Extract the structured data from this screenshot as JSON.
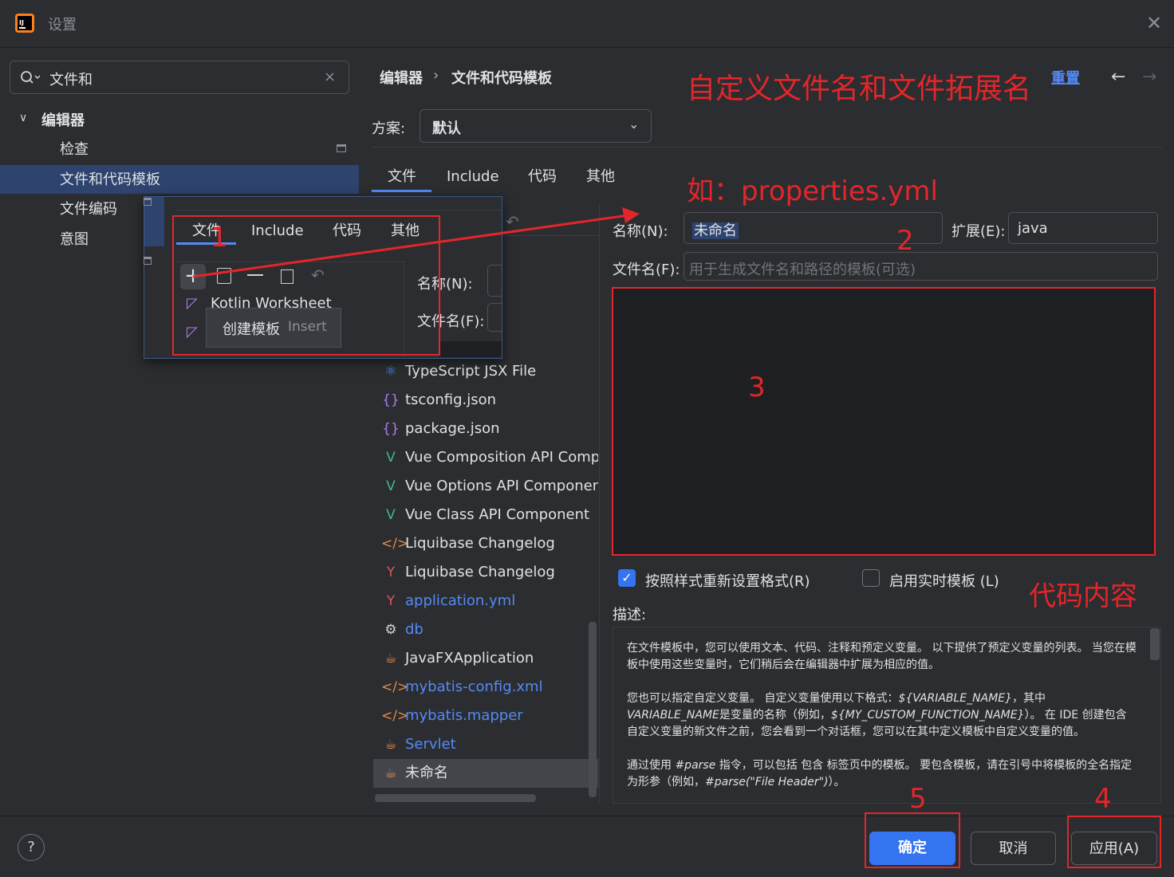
{
  "window": {
    "title": "设置",
    "close_icon": "close-icon"
  },
  "search": {
    "value": "文件和",
    "clear": "×"
  },
  "tree": {
    "root": "编辑器",
    "items": [
      "检查",
      "文件和代码模板",
      "文件编码",
      "意图"
    ]
  },
  "breadcrumb": {
    "first": "编辑器",
    "separator": "›",
    "second": "文件和代码模板"
  },
  "header": {
    "reset": "重置",
    "back": "←",
    "forward": "→"
  },
  "scheme": {
    "label": "方案:",
    "value": "默认"
  },
  "tabs": [
    "文件",
    "Include",
    "代码",
    "其他"
  ],
  "templates": [
    {
      "icon": "⚛",
      "label": "TypeScript JSX File",
      "color": "#548af7",
      "link": false
    },
    {
      "icon": "{}",
      "label": "tsconfig.json",
      "color": "#b07cf0",
      "link": false
    },
    {
      "icon": "{}",
      "label": "package.json",
      "color": "#b07cf0",
      "link": false
    },
    {
      "icon": "V",
      "label": "Vue Composition API Component",
      "color": "#41b883",
      "link": false
    },
    {
      "icon": "V",
      "label": "Vue Options API Component",
      "color": "#41b883",
      "link": false
    },
    {
      "icon": "V",
      "label": "Vue Class API Component",
      "color": "#41b883",
      "link": false
    },
    {
      "icon": "</>",
      "label": "Liquibase Changelog",
      "color": "#e38a4a",
      "link": false
    },
    {
      "icon": "Y",
      "label": "Liquibase Changelog",
      "color": "#e3525b",
      "link": false
    },
    {
      "icon": "Y",
      "label": "application.yml",
      "color": "#e3525b",
      "link": true
    },
    {
      "icon": "⚙",
      "label": "db",
      "color": "#cfd1d5",
      "link": true
    },
    {
      "icon": "☕",
      "label": "JavaFXApplication",
      "color": "#e38a4a",
      "link": false
    },
    {
      "icon": "</>",
      "label": "mybatis-config.xml",
      "color": "#e38a4a",
      "link": true
    },
    {
      "icon": "</>",
      "label": "mybatis.mapper",
      "color": "#e38a4a",
      "link": true
    },
    {
      "icon": "☕",
      "label": "Servlet",
      "color": "#e38a4a",
      "link": true
    },
    {
      "icon": "☕",
      "label": "未命名",
      "color": "#e38a4a",
      "link": false
    }
  ],
  "form": {
    "name_label": "名称(N):",
    "name_value": "未命名",
    "ext_label": "扩展(E):",
    "ext_value": "java",
    "filename_label": "文件名(F):",
    "filename_placeholder": "用于生成文件名和路径的模板(可选)",
    "reformat_label": "按照样式重新设置格式(R)",
    "reformat_checked": true,
    "live_label": "启用实时模板 (L)",
    "live_checked": false,
    "desc_label": "描述:"
  },
  "description": {
    "p1": "在文件模板中，您可以使用文本、代码、注释和预定义变量。 以下提供了预定义变量的列表。 当您在模板中使用这些变量时，它们稍后会在编辑器中扩展为相应的值。",
    "p2a": "您也可以指定自定义变量。 自定义变量使用以下格式：",
    "p2b": "${VARIABLE_NAME}",
    "p2c": "，其中",
    "p2d": "VARIABLE_NAME",
    "p2e": "是变量的名称（例如，",
    "p2f": "${MY_CUSTOM_FUNCTION_NAME}",
    "p2g": "）。 在 IDE 创建包含自定义变量的新文件之前，您会看到一个对话框，您可以在其中定义模板中自定义变量的值。",
    "p3a": "通过使用 ",
    "p3b": "#parse",
    "p3c": " 指令，可以包括 包含 标签页中的模板。 要包含模板，请在引号中将模板的全名指定为形参（例如，",
    "p3d": "#parse(\"File Header\")",
    "p3e": "）。"
  },
  "buttons": {
    "ok": "确定",
    "cancel": "取消",
    "apply": "应用(A)",
    "help": "?"
  },
  "popup": {
    "tabs": [
      "文件",
      "Include",
      "代码",
      "其他"
    ],
    "item1": "Kotlin Worksheet",
    "tooltip_label": "创建模板",
    "tooltip_key": "Insert",
    "name_label": "名称(N):",
    "filename_label": "文件名(F):"
  },
  "annotations": {
    "title": "自定义文件名和文件拓展名",
    "example": "如：properties.yml",
    "n1": "1",
    "n2": "2",
    "n3": "3",
    "n4": "4",
    "n5": "5",
    "code": "代码内容"
  },
  "colors": {
    "accent": "#3574f0",
    "link": "#548af7",
    "annotation": "#e3262a",
    "selection": "#2e436e"
  }
}
